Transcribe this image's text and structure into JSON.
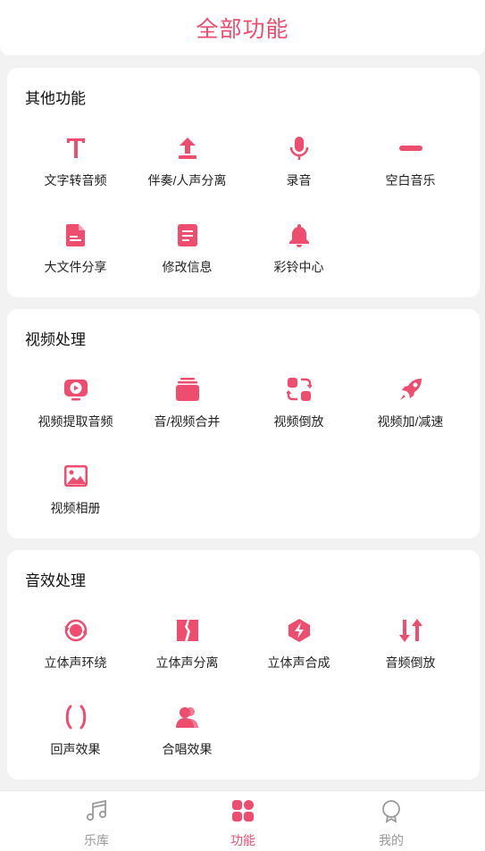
{
  "header": {
    "title": "全部功能"
  },
  "colors": {
    "accent": "#ee4d6e",
    "inactive": "#999999"
  },
  "sections": [
    {
      "title": "其他功能",
      "items": [
        {
          "label": "文字转音频",
          "icon": "text-t-icon"
        },
        {
          "label": "伴奏/人声分离",
          "icon": "upload-arrow-icon"
        },
        {
          "label": "录音",
          "icon": "microphone-icon"
        },
        {
          "label": "空白音乐",
          "icon": "minus-bar-icon"
        },
        {
          "label": "大文件分享",
          "icon": "document-icon"
        },
        {
          "label": "修改信息",
          "icon": "notes-icon"
        },
        {
          "label": "彩铃中心",
          "icon": "bell-icon"
        }
      ]
    },
    {
      "title": "视频处理",
      "items": [
        {
          "label": "视频提取音频",
          "icon": "video-play-icon"
        },
        {
          "label": "音/视频合并",
          "icon": "stack-icon"
        },
        {
          "label": "视频倒放",
          "icon": "reverse-icon"
        },
        {
          "label": "视频加/减速",
          "icon": "rocket-icon"
        },
        {
          "label": "视频相册",
          "icon": "image-icon"
        }
      ]
    },
    {
      "title": "音效处理",
      "items": [
        {
          "label": "立体声环绕",
          "icon": "surround-icon"
        },
        {
          "label": "立体声分离",
          "icon": "split-icon"
        },
        {
          "label": "立体声合成",
          "icon": "bolt-hex-icon"
        },
        {
          "label": "音频倒放",
          "icon": "swap-arrows-icon"
        },
        {
          "label": "回声效果",
          "icon": "parentheses-icon"
        },
        {
          "label": "合唱效果",
          "icon": "users-icon"
        }
      ]
    }
  ],
  "tabbar": {
    "tabs": [
      {
        "label": "乐库",
        "icon": "music-note-icon",
        "active": false
      },
      {
        "label": "功能",
        "icon": "grid-icon",
        "active": true
      },
      {
        "label": "我的",
        "icon": "profile-icon",
        "active": false
      }
    ]
  }
}
